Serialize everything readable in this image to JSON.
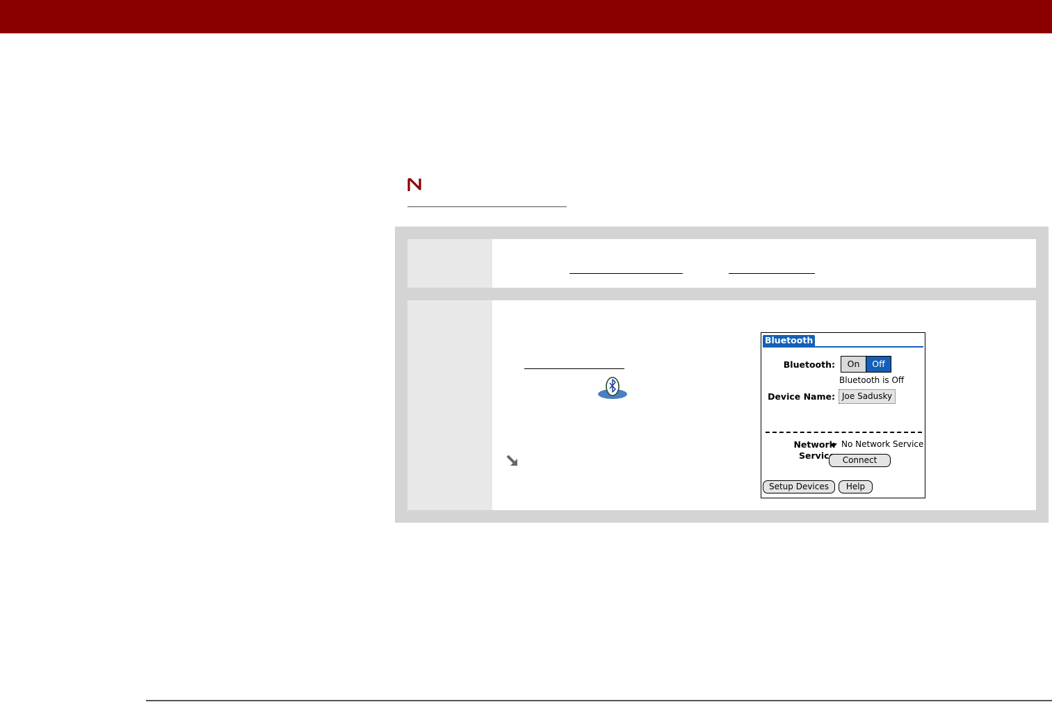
{
  "colors": {
    "header_bar": "#8a0000",
    "palm_blue": "#1460b8"
  },
  "note": {
    "icon": "note-icon"
  },
  "bluetooth_screen": {
    "tab_title": "Bluetooth",
    "bluetooth_label": "Bluetooth:",
    "on_label": "On",
    "off_label": "Off",
    "selected": "Off",
    "status_text": "Bluetooth is Off",
    "device_name_label": "Device Name:",
    "device_name_value": "Joe Sadusky",
    "network_label_line1": "Network",
    "network_label_line2": "Service",
    "network_value": "No Network Service",
    "connect_button": "Connect",
    "setup_devices_button": "Setup Devices",
    "help_button": "Help"
  },
  "icons": {
    "app_icon": "bluetooth-app-icon",
    "tip_icon": "tip-arrow-icon"
  }
}
